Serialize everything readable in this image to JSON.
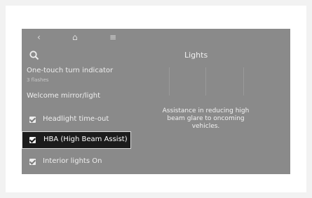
{
  "topbar": {
    "back_icon": "‹",
    "home_icon": "⌂",
    "menu_icon": "≡"
  },
  "panel": {
    "title": "Lights",
    "description": "Assistance in reducing high beam glare to oncoming vehicles."
  },
  "settings": {
    "items": [
      {
        "label": "One-touch turn indicator",
        "sub": "3 flashes"
      },
      {
        "label": "Welcome mirror/light"
      },
      {
        "label": "Headlight time-out",
        "checked": true
      },
      {
        "label": "HBA (High Beam Assist)",
        "checked": true,
        "selected": true
      },
      {
        "label": "Interior lights On",
        "checked": true
      }
    ]
  },
  "colors": {
    "screen_bg": "#8a8a8a",
    "selected_bg": "#1c1c1c"
  }
}
